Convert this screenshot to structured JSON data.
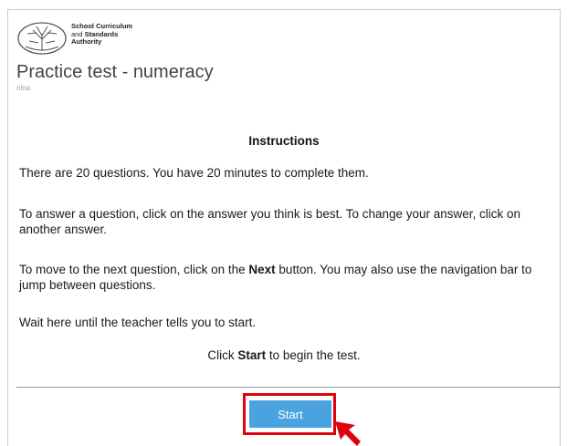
{
  "logo": {
    "line1": "School Curriculum",
    "line2_prefix": "and ",
    "line2_bold": "Standards",
    "line3": "Authority"
  },
  "page": {
    "title": "Practice test - numeracy",
    "subtitle": "olna"
  },
  "instructions": {
    "heading": "Instructions",
    "p1": "There are 20 questions. You have 20 minutes to complete them.",
    "p2": "To answer a question, click on the answer you think is best. To change your answer, click on another answer.",
    "p3_before": "To move to the next question, click on the ",
    "p3_bold": "Next",
    "p3_after": " button. You may also use the navigation bar to jump between questions.",
    "p4": "Wait here until the teacher tells you to start.",
    "p5_before": "Click ",
    "p5_bold": "Start",
    "p5_after": " to begin the test."
  },
  "start_button": {
    "label": "Start"
  },
  "colors": {
    "button": "#4aa3df",
    "highlight": "#e2000f"
  },
  "icons": {
    "logo": "scsa-tree-logo-icon",
    "pointer": "red-pointer-arrow-icon"
  }
}
